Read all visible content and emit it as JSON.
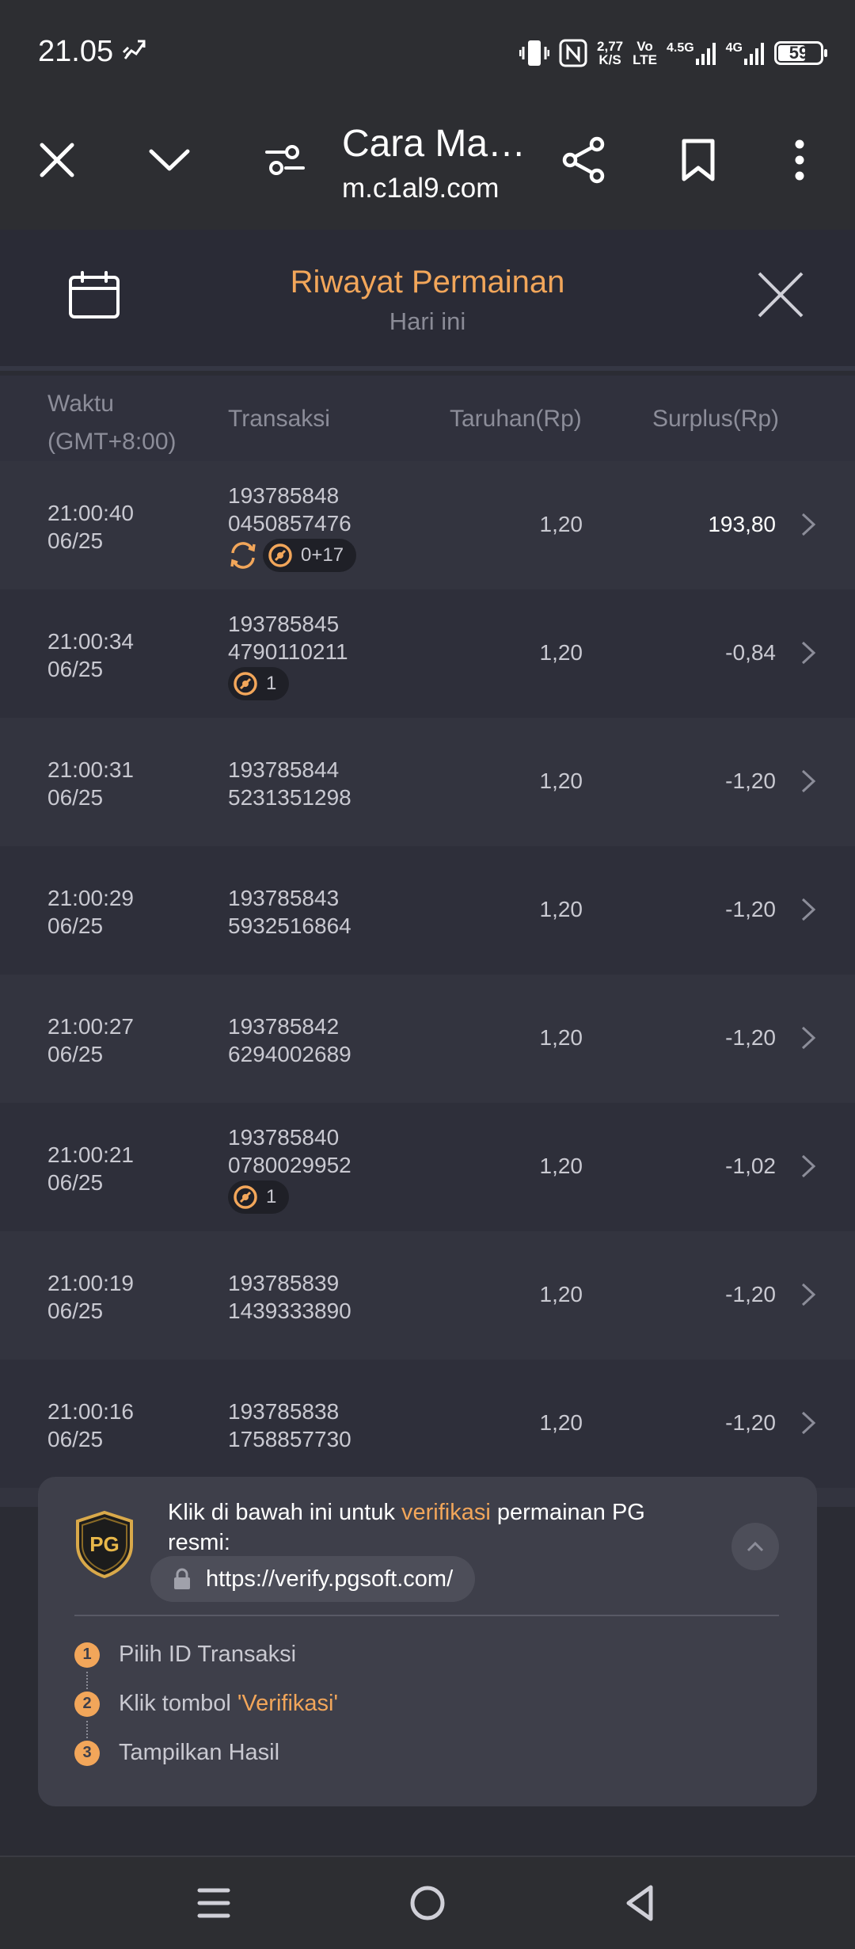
{
  "status_bar": {
    "time": "21.05",
    "net_speed_value": "2,77",
    "net_speed_unit": "K/S",
    "volte_top": "Vo",
    "volte_bottom": "LTE",
    "net1": "4.5G",
    "net2": "4G",
    "battery": "59"
  },
  "browser": {
    "page_title": "Cara Ma…",
    "url": "m.c1al9.com"
  },
  "history": {
    "title": "Riwayat Permainan",
    "subtitle": "Hari ini",
    "columns": {
      "time_line1": "Waktu",
      "time_line2": "(GMT+8:00)",
      "transaction": "Transaksi",
      "bet": "Taruhan(Rp)",
      "surplus": "Surplus(Rp)"
    },
    "rows": [
      {
        "time": "21:00:40",
        "date": "06/25",
        "id1": "193785848",
        "id2": "0450857476",
        "bet": "1,20",
        "surplus": "193,80",
        "spin_badge": true,
        "badge": "0+17"
      },
      {
        "time": "21:00:34",
        "date": "06/25",
        "id1": "193785845",
        "id2": "4790110211",
        "bet": "1,20",
        "surplus": "-0,84",
        "badge": "1"
      },
      {
        "time": "21:00:31",
        "date": "06/25",
        "id1": "193785844",
        "id2": "5231351298",
        "bet": "1,20",
        "surplus": "-1,20"
      },
      {
        "time": "21:00:29",
        "date": "06/25",
        "id1": "193785843",
        "id2": "5932516864",
        "bet": "1,20",
        "surplus": "-1,20"
      },
      {
        "time": "21:00:27",
        "date": "06/25",
        "id1": "193785842",
        "id2": "6294002689",
        "bet": "1,20",
        "surplus": "-1,20"
      },
      {
        "time": "21:00:21",
        "date": "06/25",
        "id1": "193785840",
        "id2": "0780029952",
        "bet": "1,20",
        "surplus": "-1,02",
        "badge": "1"
      },
      {
        "time": "21:00:19",
        "date": "06/25",
        "id1": "193785839",
        "id2": "1439333890",
        "bet": "1,20",
        "surplus": "-1,20"
      },
      {
        "time": "21:00:16",
        "date": "06/25",
        "id1": "193785838",
        "id2": "1758857730",
        "bet": "1,20",
        "surplus": "-1,20"
      }
    ]
  },
  "verify": {
    "logo_text": "PG",
    "text_before": "Klik di bawah ini untuk ",
    "text_highlight": "verifikasi",
    "text_after": " permainan PG resmi:",
    "url": "https://verify.pgsoft.com/",
    "steps": [
      {
        "num": "1",
        "text": "Pilih ID Transaksi",
        "highlight": ""
      },
      {
        "num": "2",
        "text": "Klik tombol ",
        "highlight": "'Verifikasi'"
      },
      {
        "num": "3",
        "text": "Tampilkan Hasil",
        "highlight": ""
      }
    ]
  },
  "colors": {
    "accent": "#f2a65a",
    "background": "#2b2c34",
    "card": "#3e3f4a"
  }
}
